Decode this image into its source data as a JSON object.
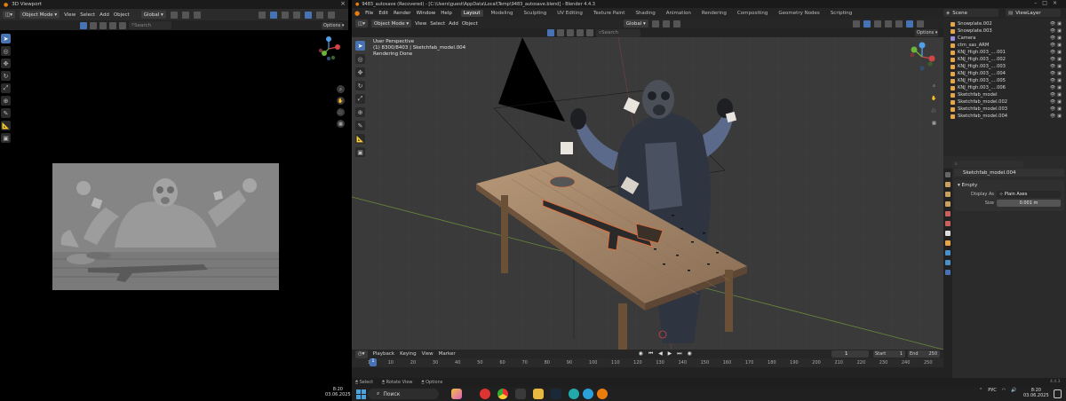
{
  "left": {
    "title": "3D Viewport",
    "mode": "Object Mode",
    "menus": [
      "View",
      "Select",
      "Add",
      "Object"
    ],
    "orientation": "Global",
    "search_placeholder": "Search",
    "options": "Options",
    "clock_time": "8:20",
    "clock_date": "03.06.2025"
  },
  "blender": {
    "title": "9483_autosave (Recovered) - [C:\\Users\\guest\\AppData\\Local\\Temp\\9483_autosave.blend] - Blender 4.4.3",
    "top_menus": [
      "File",
      "Edit",
      "Render",
      "Window",
      "Help"
    ],
    "workspaces": [
      "Layout",
      "Modeling",
      "Sculpting",
      "UV Editing",
      "Texture Paint",
      "Shading",
      "Animation",
      "Rendering",
      "Compositing",
      "Geometry Nodes",
      "Scripting"
    ],
    "active_workspace": "Layout",
    "scene": "Scene",
    "view_layer": "ViewLayer",
    "viewport": {
      "mode": "Object Mode",
      "menus": [
        "View",
        "Select",
        "Add",
        "Object"
      ],
      "orientation": "Global",
      "search_placeholder": "Search",
      "options": "Options",
      "info_line1": "User Perspective",
      "info_line2": "(1) 8300/8403 | Sketchfab_model.004",
      "info_line3": "Rendering Done"
    },
    "timeline": {
      "menus": [
        "Playback",
        "Keying",
        "View",
        "Marker"
      ],
      "current_frame": "1",
      "start_label": "Start",
      "start": "1",
      "end_label": "End",
      "end": "250",
      "ticks": [
        "1",
        "10",
        "20",
        "30",
        "40",
        "50",
        "60",
        "70",
        "80",
        "90",
        "100",
        "110",
        "120",
        "130",
        "140",
        "150",
        "160",
        "170",
        "180",
        "190",
        "200",
        "210",
        "220",
        "230",
        "240",
        "250"
      ]
    },
    "outliner": [
      {
        "name": "Snowplate.002",
        "icon": "mesh",
        "color": "#e8a44a"
      },
      {
        "name": "Snowplate.003",
        "icon": "mesh",
        "color": "#e8a44a"
      },
      {
        "name": "Camera",
        "icon": "camera",
        "color": "#9a8fe0"
      },
      {
        "name": "ctm_sas_ARM",
        "icon": "armature",
        "color": "#e8a44a"
      },
      {
        "name": "KNJ_High.003_....001",
        "icon": "mesh",
        "color": "#e8a44a"
      },
      {
        "name": "KNJ_High.003_....002",
        "icon": "mesh",
        "color": "#e8a44a"
      },
      {
        "name": "KNJ_High.003_....003",
        "icon": "mesh",
        "color": "#e8a44a"
      },
      {
        "name": "KNJ_High.003_....004",
        "icon": "mesh",
        "color": "#e8a44a"
      },
      {
        "name": "KNJ_High.003_....005",
        "icon": "mesh",
        "color": "#e8a44a"
      },
      {
        "name": "KNJ_High.003_....006",
        "icon": "mesh",
        "color": "#e8a44a"
      },
      {
        "name": "Sketchfab_model",
        "icon": "empty",
        "color": "#e8a44a"
      },
      {
        "name": "Sketchfab_model.002",
        "icon": "empty",
        "color": "#e8a44a"
      },
      {
        "name": "Sketchfab_model.003",
        "icon": "empty",
        "color": "#e8a44a"
      },
      {
        "name": "Sketchfab_model.004",
        "icon": "empty",
        "color": "#e8a44a"
      }
    ],
    "properties": {
      "object_name": "Sketchfab_model.004",
      "panel": "Empty",
      "display_as_label": "Display As",
      "display_as": "Plain Axes",
      "size_label": "Size",
      "size": "0.001 m"
    },
    "status": [
      "Select",
      "Rotate View",
      "Options"
    ],
    "version": "4.4.3"
  },
  "taskbar": {
    "search": "Поиск",
    "lang": "РУС",
    "clock_time": "8:20",
    "clock_date": "03.06.2025"
  },
  "colors": {
    "accent": "#4772b3",
    "viewport_bg": "#3a3a3a",
    "panel_bg": "#2b2b2b"
  }
}
